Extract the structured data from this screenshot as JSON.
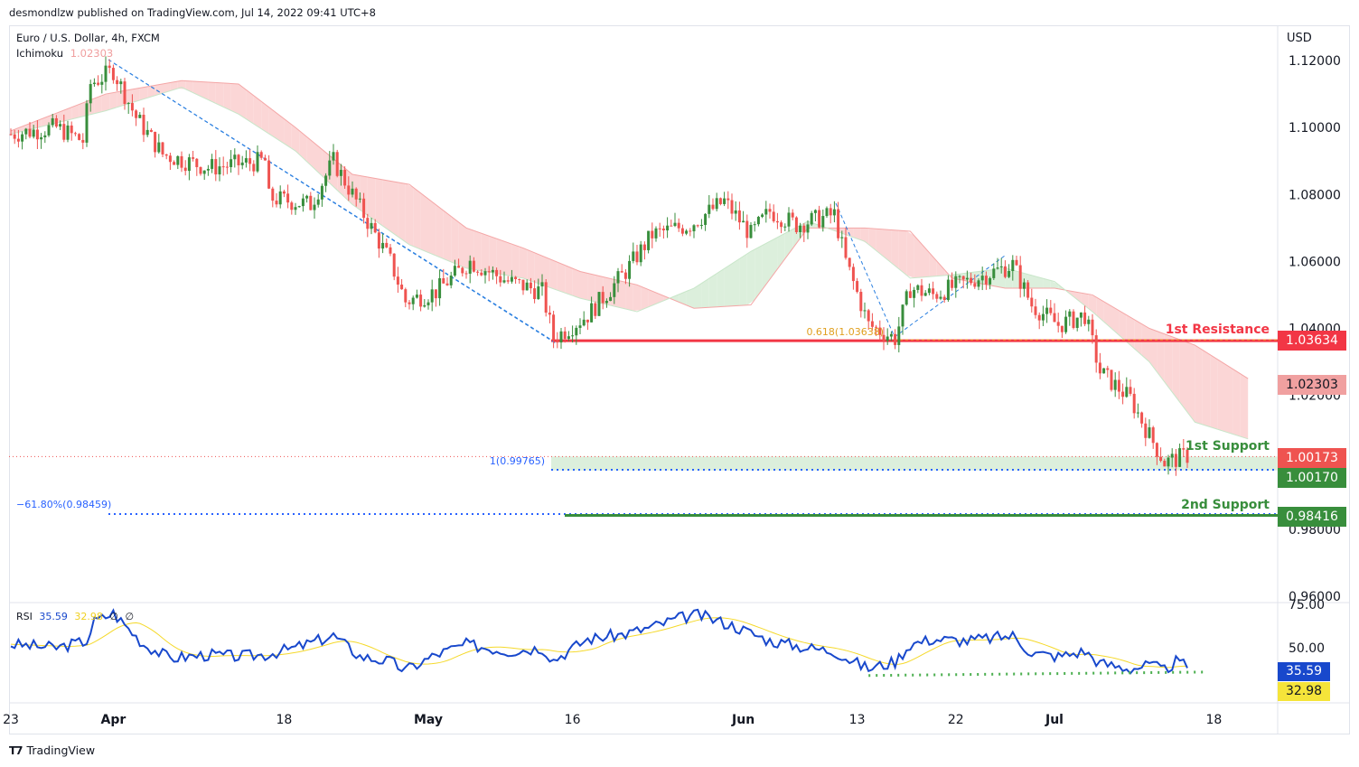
{
  "header": {
    "published": "desmondlzw published on TradingView.com, Jul 14, 2022 09:41 UTC+8"
  },
  "legend": {
    "symbol": "Euro / U.S. Dollar, 4h, FXCM",
    "ichimoku_label": "Ichimoku",
    "ichimoku_value": "1.02303"
  },
  "rsi_legend": {
    "label": "RSI",
    "value": "35.59",
    "ma_value": "32.98",
    "extra1": "∅",
    "extra2": "∅"
  },
  "footer": {
    "brand": "TradingView"
  },
  "annotations": {
    "resistance1": "1st Resistance",
    "support1": "1st Support",
    "support2": "2nd Support",
    "fib618": "0.618(1.03638)",
    "fib1": "1(0.99765)",
    "fib_neg": "−61.80%(0.98459)"
  },
  "price_tags": {
    "resistance": "1.03634",
    "ichimoku": "1.02303",
    "last": "1.00173",
    "support1": "1.00170",
    "support2": "0.98416"
  },
  "rsi_tags": {
    "rsi": "35.59",
    "ma": "32.98"
  },
  "colors": {
    "up": "#26a69a",
    "candle_up": "#388e3c",
    "candle_down": "#ef5350",
    "resistance": "#f23645",
    "support": "#388e3c",
    "fib": "#2962ff",
    "rsi": "#1848cc",
    "rsi_ma": "#f5d92a",
    "cloud_red": "#fbd6d6",
    "cloud_green": "#dcefdc"
  },
  "chart_data": {
    "type": "candlestick",
    "title": "Euro / U.S. Dollar, 4h, FXCM",
    "currency": "USD",
    "y_ticks": [
      "1.12000",
      "1.10000",
      "1.08000",
      "1.06000",
      "1.04000",
      "1.02000",
      "1.00000",
      "0.98000",
      "0.96000"
    ],
    "ylim": [
      0.96,
      1.12
    ],
    "x_ticks": [
      {
        "label": "23",
        "bar": 0
      },
      {
        "label": "Apr",
        "bar": 27,
        "bold": true
      },
      {
        "label": "18",
        "bar": 72
      },
      {
        "label": "May",
        "bar": 110,
        "bold": true
      },
      {
        "label": "16",
        "bar": 148
      },
      {
        "label": "Jun",
        "bar": 193,
        "bold": true
      },
      {
        "label": "13",
        "bar": 223
      },
      {
        "label": "22",
        "bar": 249
      },
      {
        "label": "Jul",
        "bar": 275,
        "bold": true
      },
      {
        "label": "18",
        "bar": 317
      }
    ],
    "price_path": [
      [
        0,
        1.098
      ],
      [
        12,
        1.1
      ],
      [
        19,
        1.096
      ],
      [
        21,
        1.113
      ],
      [
        27,
        1.117
      ],
      [
        33,
        1.103
      ],
      [
        40,
        1.092
      ],
      [
        52,
        1.088
      ],
      [
        67,
        1.09
      ],
      [
        68,
        1.079
      ],
      [
        79,
        1.077
      ],
      [
        85,
        1.09
      ],
      [
        93,
        1.074
      ],
      [
        100,
        1.06
      ],
      [
        104,
        1.048
      ],
      [
        112,
        1.051
      ],
      [
        121,
        1.06
      ],
      [
        131,
        1.054
      ],
      [
        140,
        1.051
      ],
      [
        143,
        1.037
      ],
      [
        152,
        1.044
      ],
      [
        162,
        1.057
      ],
      [
        169,
        1.068
      ],
      [
        179,
        1.071
      ],
      [
        188,
        1.078
      ],
      [
        195,
        1.068
      ],
      [
        200,
        1.075
      ],
      [
        207,
        1.071
      ],
      [
        217,
        1.074
      ],
      [
        220,
        1.06
      ],
      [
        226,
        1.041
      ],
      [
        233,
        1.037
      ],
      [
        237,
        1.052
      ],
      [
        243,
        1.05
      ],
      [
        252,
        1.054
      ],
      [
        264,
        1.059
      ],
      [
        269,
        1.047
      ],
      [
        276,
        1.041
      ],
      [
        283,
        1.044
      ],
      [
        287,
        1.027
      ],
      [
        295,
        1.019
      ],
      [
        300,
        1.008
      ],
      [
        304,
        1.0
      ],
      [
        310,
        1.002
      ]
    ],
    "ichimoku_span_a": [
      [
        0,
        1.098
      ],
      [
        25,
        1.105
      ],
      [
        45,
        1.112
      ],
      [
        60,
        1.104
      ],
      [
        75,
        1.093
      ],
      [
        90,
        1.077
      ],
      [
        105,
        1.065
      ],
      [
        120,
        1.058
      ],
      [
        135,
        1.055
      ],
      [
        150,
        1.049
      ],
      [
        165,
        1.045
      ],
      [
        180,
        1.052
      ],
      [
        195,
        1.063
      ],
      [
        210,
        1.072
      ],
      [
        225,
        1.066
      ],
      [
        237,
        1.055
      ],
      [
        248,
        1.056
      ],
      [
        262,
        1.058
      ],
      [
        275,
        1.054
      ],
      [
        285,
        1.045
      ],
      [
        300,
        1.03
      ],
      [
        312,
        1.012
      ],
      [
        326,
        1.007
      ]
    ],
    "ichimoku_span_b": [
      [
        0,
        1.099
      ],
      [
        25,
        1.11
      ],
      [
        45,
        1.114
      ],
      [
        60,
        1.113
      ],
      [
        75,
        1.1
      ],
      [
        90,
        1.086
      ],
      [
        105,
        1.083
      ],
      [
        120,
        1.07
      ],
      [
        135,
        1.064
      ],
      [
        150,
        1.057
      ],
      [
        165,
        1.053
      ],
      [
        180,
        1.046
      ],
      [
        195,
        1.047
      ],
      [
        210,
        1.07
      ],
      [
        225,
        1.07
      ],
      [
        237,
        1.069
      ],
      [
        248,
        1.055
      ],
      [
        262,
        1.052
      ],
      [
        275,
        1.052
      ],
      [
        285,
        1.05
      ],
      [
        300,
        1.04
      ],
      [
        312,
        1.035
      ],
      [
        326,
        1.025
      ]
    ],
    "levels": {
      "resistance1": 1.03634,
      "support1": 1.00173,
      "support1_zone_low": 0.9976,
      "support2": 0.98416,
      "fib_neg": 0.98459
    },
    "rsi": {
      "y_ticks": [
        "75.00",
        "50.00"
      ],
      "path": [
        [
          0,
          52
        ],
        [
          12,
          50
        ],
        [
          20,
          54
        ],
        [
          22,
          65
        ],
        [
          27,
          70
        ],
        [
          35,
          52
        ],
        [
          42,
          44
        ],
        [
          52,
          46
        ],
        [
          60,
          45
        ],
        [
          67,
          46
        ],
        [
          75,
          50
        ],
        [
          85,
          57
        ],
        [
          92,
          45
        ],
        [
          100,
          42
        ],
        [
          104,
          37
        ],
        [
          112,
          46
        ],
        [
          120,
          52
        ],
        [
          131,
          48
        ],
        [
          140,
          50
        ],
        [
          143,
          43
        ],
        [
          152,
          55
        ],
        [
          162,
          58
        ],
        [
          169,
          62
        ],
        [
          176,
          67
        ],
        [
          181,
          69
        ],
        [
          190,
          63
        ],
        [
          200,
          54
        ],
        [
          210,
          50
        ],
        [
          217,
          48
        ],
        [
          222,
          42
        ],
        [
          226,
          38
        ],
        [
          233,
          42
        ],
        [
          237,
          52
        ],
        [
          243,
          55
        ],
        [
          252,
          54
        ],
        [
          264,
          57
        ],
        [
          269,
          47
        ],
        [
          276,
          45
        ],
        [
          283,
          48
        ],
        [
          287,
          41
        ],
        [
          295,
          38
        ],
        [
          300,
          40
        ],
        [
          304,
          37
        ],
        [
          307,
          42
        ],
        [
          310,
          39
        ]
      ],
      "support_line": [
        [
          226,
          34
        ],
        [
          315,
          36
        ]
      ]
    }
  }
}
